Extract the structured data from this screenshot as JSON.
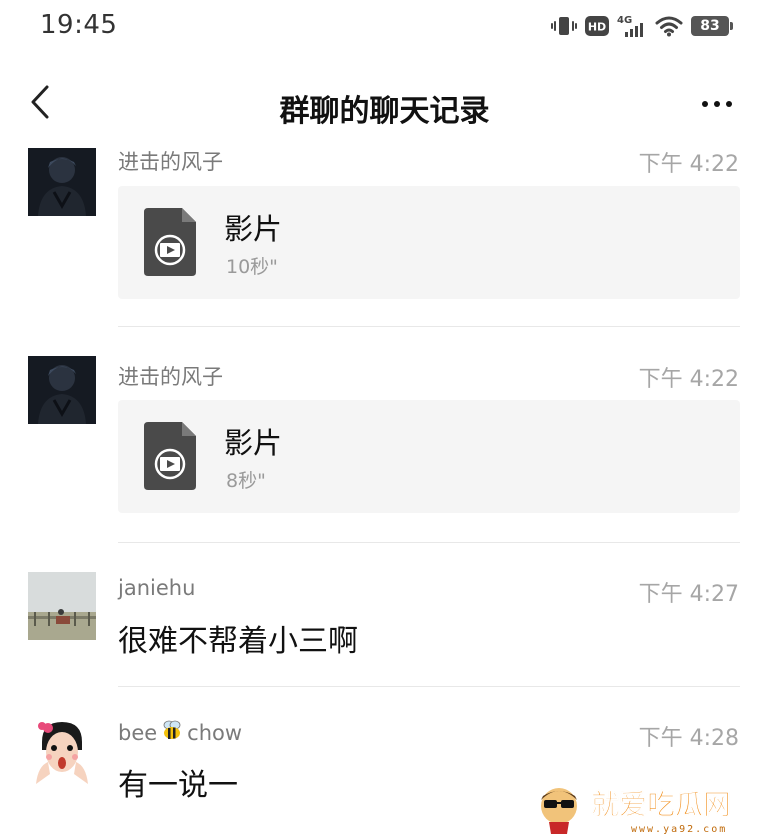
{
  "status_bar": {
    "time": "19:45",
    "network": "4G",
    "hd_label": "HD",
    "battery": "83"
  },
  "nav": {
    "title": "群聊的聊天记录",
    "back_icon": "chevron-left-icon",
    "more_icon": "more-dots-icon"
  },
  "messages": [
    {
      "sender": "进击的风子",
      "time": "下午 4:22",
      "type": "video",
      "title": "影片",
      "duration": "10秒\""
    },
    {
      "sender": "进击的风子",
      "time": "下午 4:22",
      "type": "video",
      "title": "影片",
      "duration": "8秒\""
    },
    {
      "sender": "janiehu",
      "time": "下午 4:27",
      "type": "text",
      "text": "很难不帮着小三啊"
    },
    {
      "sender_prefix": "bee",
      "sender_suffix": "chow",
      "sender_emoji_icon": "bee-icon",
      "time": "下午 4:28",
      "type": "text",
      "text": "有一说一"
    }
  ],
  "watermark": {
    "text": "就爱吃瓜网",
    "url": "www.ya92.com"
  },
  "colors": {
    "card_bg": "#f5f5f5",
    "meta_text": "#a6a6a6",
    "watermark_orange": "#f08a12"
  }
}
